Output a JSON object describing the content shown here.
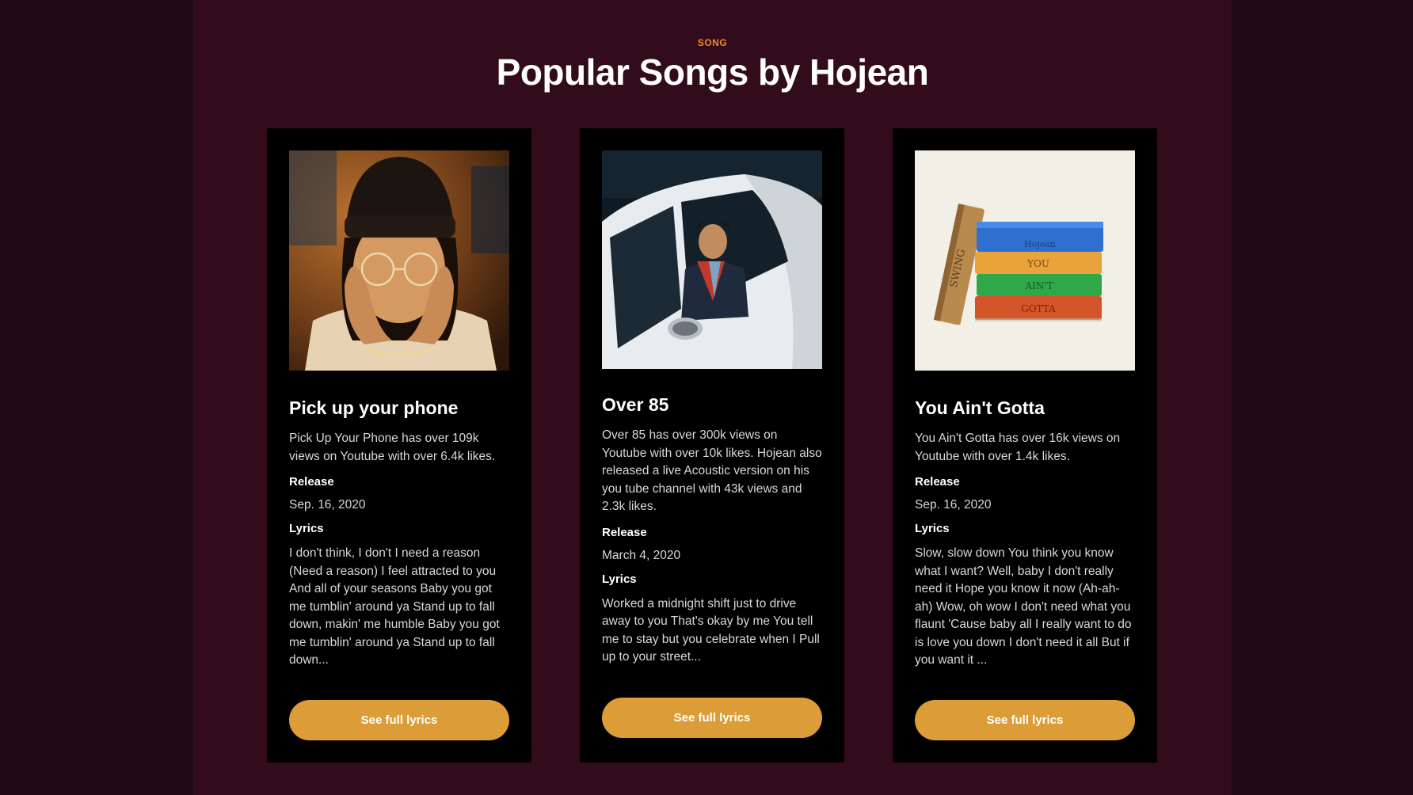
{
  "section": {
    "eyebrow": "SONG",
    "title": "Popular Songs by Hojean"
  },
  "colors": {
    "page_bg": "#1f0a14",
    "section_bg": "#330c1c",
    "card_bg": "#000000",
    "accent": "#f08b2c",
    "button": "#dc9c37"
  },
  "songs": [
    {
      "title": "Pick up your phone",
      "description": "Pick Up Your Phone has over 109k views on Youtube with over 6.4k likes.",
      "release_label": "Release",
      "release_date": "Sep. 16, 2020",
      "lyrics_label": "Lyrics",
      "lyrics": "I don't think, I don't I need a reason (Need a reason) I feel attracted to you And all of your seasons Baby you got me tumblin' around ya Stand up to fall down, makin' me humble Baby you got me tumblin' around ya Stand up to fall down...",
      "button": "See full lyrics",
      "art_icon": "portrait-photo"
    },
    {
      "title": "Over 85",
      "description": "Over 85 has over 300k views on Youtube with over 10k likes. Hojean also released a live Acoustic version on his you tube channel with 43k views and 2.3k likes.",
      "release_label": "Release",
      "release_date": "March 4, 2020",
      "lyrics_label": "Lyrics",
      "lyrics": "Worked a midnight shift just to drive away to you That's okay by me You tell me to stay but you celebrate when I Pull up to your street...",
      "button": "See full lyrics",
      "art_icon": "car-photo"
    },
    {
      "title": "You Ain't Gotta",
      "description": "You Ain't Gotta has over 16k views on Youtube with over 1.4k likes.",
      "release_label": "Release",
      "release_date": "Sep. 16, 2020",
      "lyrics_label": "Lyrics",
      "lyrics": "Slow, slow down You think you know what I want? Well, baby I don't really need it Hope you know it now (Ah-ah-ah) Wow, oh wow I don't need what you flaunt 'Cause baby all I really want to do is love you down I don't need it all But if you want it ...",
      "button": "See full lyrics",
      "art_icon": "book-stack-art",
      "art_text": {
        "spine": "SWING",
        "book1": "Hojean",
        "book2": "YOU",
        "book3": "AIN'T",
        "book4": "GOTTA"
      }
    }
  ]
}
